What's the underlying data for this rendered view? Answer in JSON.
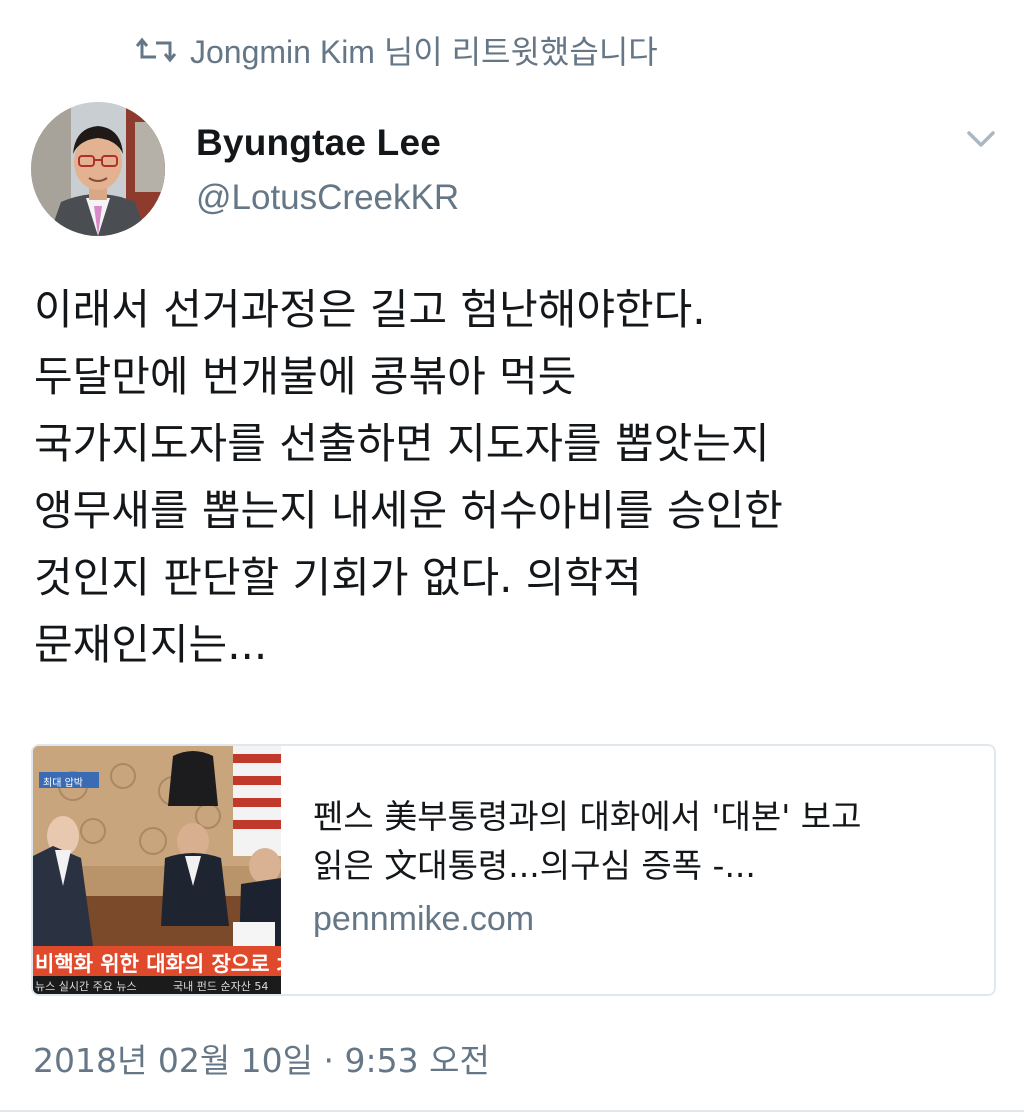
{
  "retweet": {
    "icon": "retweet-icon",
    "text": "Jongmin Kim 님이 리트윗했습니다"
  },
  "author": {
    "display_name": "Byungtae Lee",
    "handle": "@LotusCreekKR",
    "avatar_icon": "avatar"
  },
  "menu": {
    "icon": "chevron-down-icon"
  },
  "tweet": {
    "lines": [
      "이래서 선거과정은 길고 험난해야한다.",
      "두달만에 번개불에 콩볶아 먹듯",
      "국가지도자를 선출하면 지도자를 뽑앗는지",
      "앵무새를 뽑는지 내세운 허수아비를 승인한",
      "것인지 판단할 기회가 없다. 의학적",
      "문재인지는..."
    ]
  },
  "card": {
    "title_lines": [
      "펜스 美부통령과의 대화에서 '대본' 보고",
      "읽은 文대통령...의구심 증폭 -..."
    ],
    "domain": "pennmike.com",
    "thumbnail": {
      "tag": "최대 압박",
      "caption": "비핵화 위한 대화의 장으로 北 C",
      "ticker_left": "뉴스 실시간 주요 뉴스",
      "ticker_right": "국내 펀드 순자산 54"
    }
  },
  "timestamp": "2018년 02월 10일 · 9:53 오전",
  "colors": {
    "text_primary": "#14171a",
    "text_secondary": "#657786",
    "border": "#e1e8ed"
  }
}
